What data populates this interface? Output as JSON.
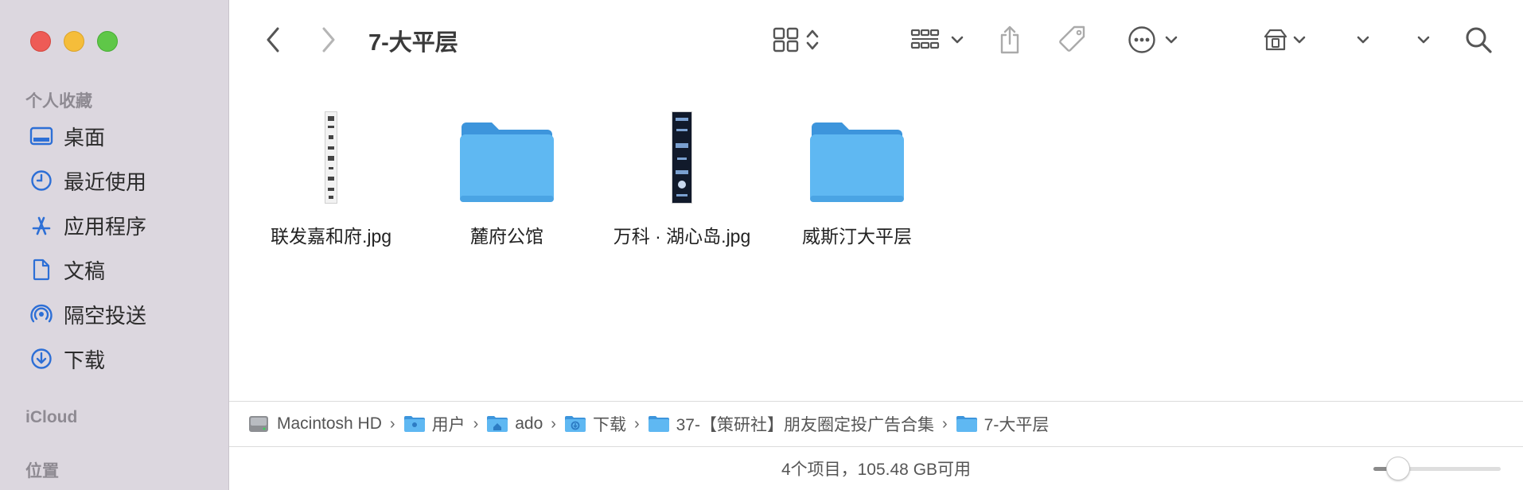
{
  "window": {
    "title": "7-大平层"
  },
  "sidebar": {
    "favorites_heading": "个人收藏",
    "items": [
      {
        "label": "桌面",
        "icon": "desktop-icon"
      },
      {
        "label": "最近使用",
        "icon": "clock-icon"
      },
      {
        "label": "应用程序",
        "icon": "applications-icon"
      },
      {
        "label": "文稿",
        "icon": "document-icon"
      },
      {
        "label": "隔空投送",
        "icon": "airdrop-icon"
      },
      {
        "label": "下载",
        "icon": "download-icon"
      }
    ],
    "icloud_heading": "iCloud",
    "locations_heading": "位置"
  },
  "files": [
    {
      "name": "联发嘉和府.jpg",
      "kind": "image"
    },
    {
      "name": "麓府公馆",
      "kind": "folder"
    },
    {
      "name": "万科 · 湖心岛.jpg",
      "kind": "image"
    },
    {
      "name": "威斯汀大平层",
      "kind": "folder"
    }
  ],
  "pathbar": [
    {
      "label": "Macintosh HD",
      "icon": "hard-drive-icon"
    },
    {
      "label": "用户",
      "icon": "folder-icon"
    },
    {
      "label": "ado",
      "icon": "home-folder-icon"
    },
    {
      "label": "下载",
      "icon": "downloads-folder-icon"
    },
    {
      "label": "37-【策研社】朋友圈定投广告合集",
      "icon": "folder-icon"
    },
    {
      "label": "7-大平层",
      "icon": "folder-icon"
    }
  ],
  "status": {
    "text": "4个项目，105.48 GB可用"
  },
  "icon_size_slider": {
    "value": 0.2
  },
  "colors": {
    "folder": "#5fb8f2",
    "accent": "#2d6fd6"
  }
}
